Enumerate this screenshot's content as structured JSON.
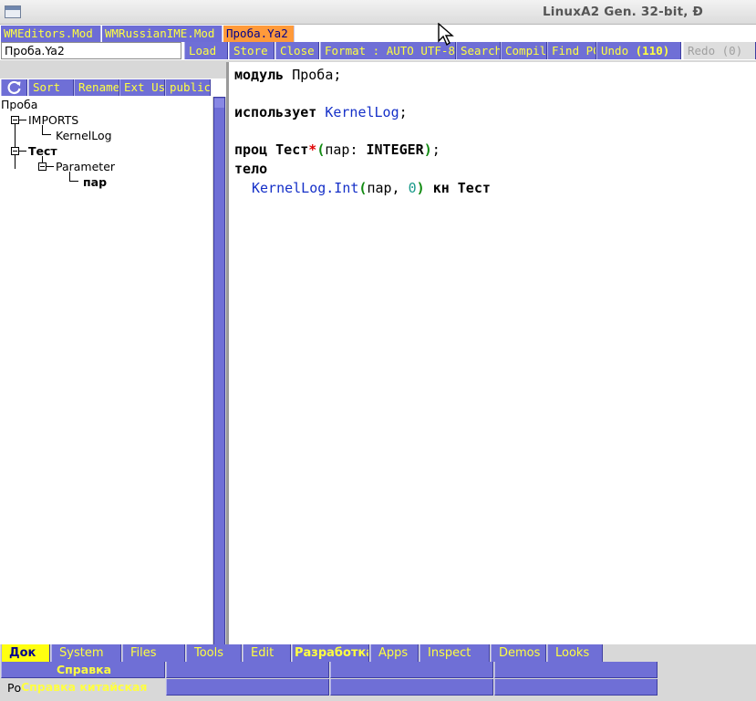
{
  "window": {
    "title": "LinuxA2 Gen. 32-bit, Ð"
  },
  "tabs": [
    "WMEditors.Mod",
    "WMRussianIME.Mod",
    "Проба.Ya2"
  ],
  "active_tab": "Проба.Ya2",
  "toolbar": {
    "filename_value": "Проба.Ya2",
    "load": "Load",
    "store": "Store !",
    "close": "Close",
    "format": "Format : AUTO UTF-8",
    "search": "Search",
    "compile": "Compile",
    "findpc": "Find PC",
    "undo_label": "Undo",
    "undo_count": "(110)",
    "redo_label": "Redo",
    "redo_count": "(0)"
  },
  "left_toolbar": {
    "refresh_icon": "refresh-icon",
    "sort": "Sort",
    "rename": "Rename",
    "ext": "Ext Us",
    "public": "public"
  },
  "tree": {
    "root": "Проба",
    "imports": "IMPORTS",
    "import_item": "KernelLog",
    "proc": "Тест",
    "parameter": "Parameter",
    "param_item": "пар"
  },
  "code": {
    "l1_kw": "модуль",
    "l1_name": "Проба",
    "l1_semi": ";",
    "l3_kw": "использует",
    "l3_name": "KernelLog",
    "l3_semi": ";",
    "l5_kw": "проц",
    "l5_name": "Тест",
    "l5_star": "*",
    "l5_lp": "(",
    "l5_param": "пар",
    "l5_colon": ":",
    "l5_type": "INTEGER",
    "l5_rp": ")",
    "l5_semi": ";",
    "l6_kw": "тело",
    "l7_call": "KernelLog.Int",
    "l7_lp": "(",
    "l7_arg": "пар",
    "l7_comma": ",",
    "l7_num": "0",
    "l7_rp": ")",
    "l7_kw": "кн",
    "l7_name": "Тест"
  },
  "menu": [
    "Док",
    "System",
    "Files",
    "Tools",
    "Edit",
    "Разработка",
    "Apps",
    "Inspect",
    "Demos",
    "Looks"
  ],
  "active_menu": "Док",
  "submenu": {
    "item1": "Справка",
    "item2": "Справка китайская"
  },
  "status": {
    "text": "Ро"
  },
  "colors": {
    "tab_blue": "#6d6dd6",
    "tab_active": "#ff9a3a",
    "label_yellow": "#ffff40",
    "code_blue": "#1530c8",
    "code_red": "#e00000",
    "code_green": "#108a10"
  }
}
